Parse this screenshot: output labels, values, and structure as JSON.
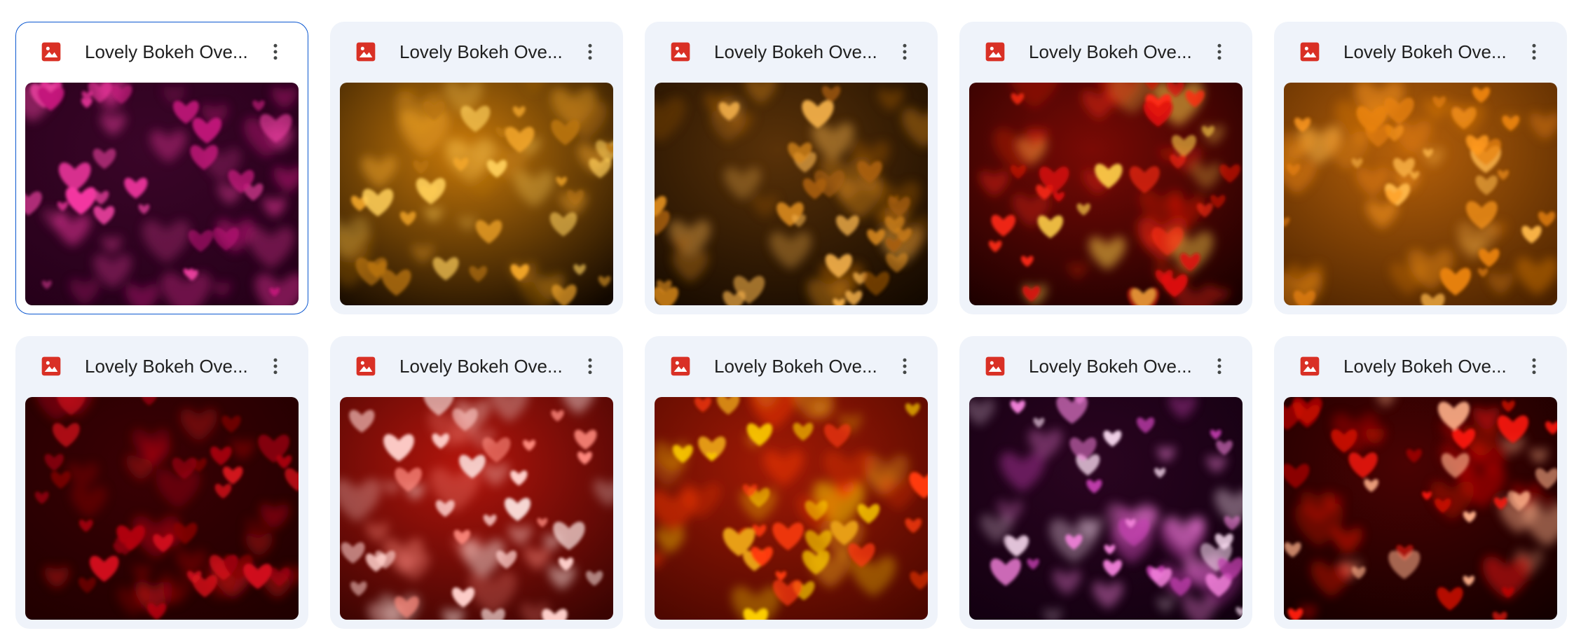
{
  "colors": {
    "accent": "#0b57d0",
    "card_bg": "#eff3fa",
    "image_icon": "#d93025",
    "text": "#1f1f1f"
  },
  "files": [
    {
      "name": "Lovely Bokeh Ove...",
      "icon": "image-file-icon",
      "selected": true,
      "palette": "magenta-dark",
      "bg": [
        "#3a0528",
        "#250019"
      ],
      "hearts": [
        "#ff3aa8",
        "#c2187a",
        "#e63f9c"
      ]
    },
    {
      "name": "Lovely Bokeh Ove...",
      "icon": "image-file-icon",
      "selected": false,
      "palette": "amber-glow",
      "bg": [
        "#c97a0a",
        "#120800"
      ],
      "hearts": [
        "#f0a428",
        "#b8730f",
        "#ffcf5a"
      ]
    },
    {
      "name": "Lovely Bokeh Ove...",
      "icon": "image-file-icon",
      "selected": false,
      "palette": "amber-dark",
      "bg": [
        "#5a3208",
        "#140900"
      ],
      "hearts": [
        "#d9891c",
        "#a85f0b",
        "#f3b04a"
      ]
    },
    {
      "name": "Lovely Bokeh Ove...",
      "icon": "image-file-icon",
      "selected": false,
      "palette": "red-gold",
      "bg": [
        "#7a0a05",
        "#1a0000"
      ],
      "hearts": [
        "#ff2a14",
        "#e0120a",
        "#ffd24a"
      ]
    },
    {
      "name": "Lovely Bokeh Ove...",
      "icon": "image-file-icon",
      "selected": false,
      "palette": "orange-soft",
      "bg": [
        "#b8620a",
        "#4a2200"
      ],
      "hearts": [
        "#ff9a1e",
        "#e8820f",
        "#ffb84a"
      ]
    },
    {
      "name": "Lovely Bokeh Ove...",
      "icon": "image-file-icon",
      "selected": false,
      "palette": "deep-red",
      "bg": [
        "#3a0004",
        "#200000"
      ],
      "hearts": [
        "#b3000f",
        "#8a0008",
        "#d4121c"
      ]
    },
    {
      "name": "Lovely Bokeh Ove...",
      "icon": "image-file-icon",
      "selected": false,
      "palette": "red-white",
      "bg": [
        "#b3150c",
        "#3a0402"
      ],
      "hearts": [
        "#ffd0cc",
        "#ff8a7e",
        "#ffe7e4"
      ]
    },
    {
      "name": "Lovely Bokeh Ove...",
      "icon": "image-file-icon",
      "selected": false,
      "palette": "red-orange",
      "bg": [
        "#a11a05",
        "#4a0700"
      ],
      "hearts": [
        "#ff3b0a",
        "#e8a018",
        "#ffd200"
      ]
    },
    {
      "name": "Lovely Bokeh Ove...",
      "icon": "image-file-icon",
      "selected": false,
      "palette": "purple-pink",
      "bg": [
        "#2a0420",
        "#120010"
      ],
      "hearts": [
        "#f07fd8",
        "#c43fb0",
        "#ffe0f6"
      ]
    },
    {
      "name": "Lovely Bokeh Ove...",
      "icon": "image-file-icon",
      "selected": false,
      "palette": "red-black",
      "bg": [
        "#4a0202",
        "#140000"
      ],
      "hearts": [
        "#ff1a0e",
        "#c90805",
        "#ffb08a"
      ]
    }
  ],
  "more_icon": "more-vert-icon"
}
